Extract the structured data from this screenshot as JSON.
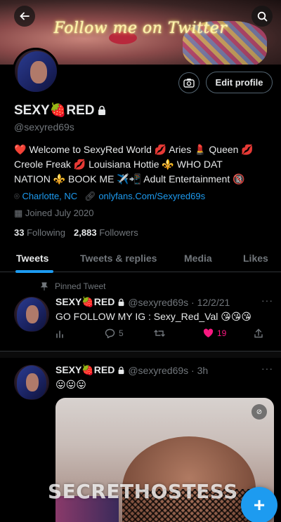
{
  "banner": {
    "text": "Follow me on Twitter"
  },
  "header": {
    "back_icon": "arrow-left-icon",
    "search_icon": "search-icon"
  },
  "profile": {
    "name": "SEXY🍓RED",
    "handle": "@sexyred69s",
    "edit_label": "Edit profile",
    "bio_line1": "❤️ Welcome to SexyRed World 💋 Aries 💄 Queen 💋",
    "bio_line2": "Creole Freak 💋 Louisiana Hottie ⚜️ WHO DAT",
    "bio_line3": "NATION ⚜️ BOOK ME ✈️📲 Adult Entertainment 🔞",
    "location": "Charlotte, NC",
    "website": "onlyfans.Com/Sexyred69s",
    "joined": "Joined July 2020",
    "following_count": "33",
    "following_label": "Following",
    "followers_count": "2,883",
    "followers_label": "Followers"
  },
  "tabs": [
    "Tweets",
    "Tweets & replies",
    "Media",
    "Likes"
  ],
  "pinned_label": "Pinned Tweet",
  "tweet1": {
    "name": "SEXY🍓RED",
    "handle_time": "@sexyred69s · 12/2/21",
    "text": "GO FOLLOW MY IG : Sexy_Red_Val 😘😘😘",
    "replies": "5",
    "likes": "19"
  },
  "tweet2": {
    "name": "SEXY🍓RED",
    "handle_time": "@sexyred69s · 3h",
    "text": "😛😛😛",
    "gif_label": "⊘"
  },
  "more_label": "···",
  "watermark": "SECRETHOSTESS",
  "fab_label": "+"
}
